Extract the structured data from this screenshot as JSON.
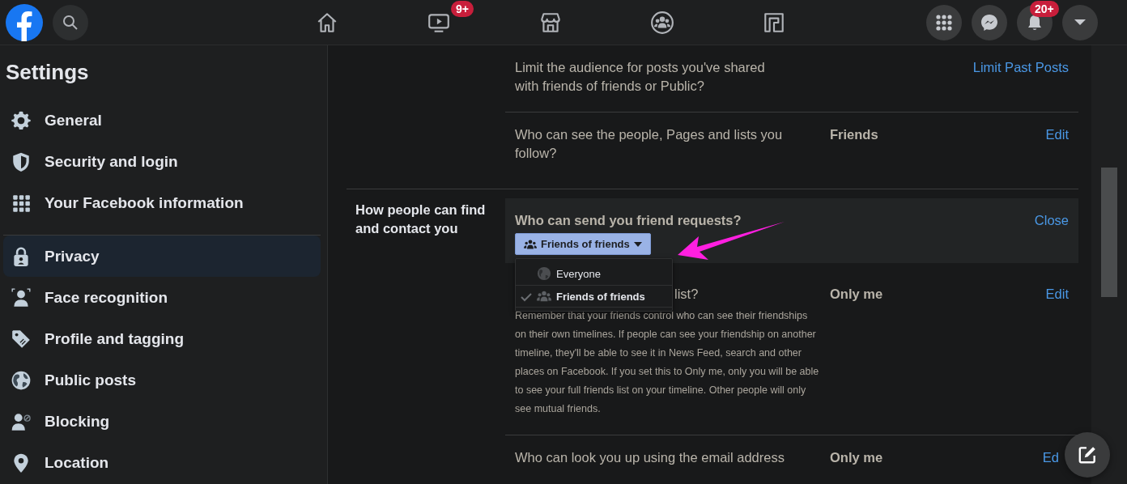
{
  "topbar": {
    "nav": [
      {
        "kind": "home",
        "selected": false
      },
      {
        "kind": "watch",
        "selected": false,
        "badge": "9+"
      },
      {
        "kind": "marketplace",
        "selected": false
      },
      {
        "kind": "groups",
        "selected": false
      },
      {
        "kind": "gaming",
        "selected": false
      }
    ],
    "actions": [
      {
        "kind": "menu"
      },
      {
        "kind": "messenger"
      },
      {
        "kind": "notifications",
        "badge": "20+"
      },
      {
        "kind": "account"
      }
    ]
  },
  "sidebar": {
    "title": "Settings",
    "groups": [
      [
        {
          "kind": "gear",
          "label": "General",
          "selected": false
        },
        {
          "kind": "shield",
          "label": "Security and login",
          "selected": false
        },
        {
          "kind": "grid",
          "label": "Your Facebook information",
          "selected": false
        }
      ],
      [
        {
          "kind": "lock",
          "label": "Privacy",
          "selected": true
        },
        {
          "kind": "face",
          "label": "Face recognition",
          "selected": false
        },
        {
          "kind": "tag",
          "label": "Profile and tagging",
          "selected": false
        },
        {
          "kind": "globe",
          "label": "Public posts",
          "selected": false
        },
        {
          "kind": "block",
          "label": "Blocking",
          "selected": false
        },
        {
          "kind": "pin",
          "label": "Location",
          "selected": false
        }
      ]
    ]
  },
  "sections": [
    {
      "rows": [
        {
          "kind": "collapsed",
          "question": [
            "Limit the audience for posts you've shared",
            "with friends of friends or Public?"
          ],
          "link": "Limit Past Posts"
        },
        {
          "kind": "collapsed",
          "question": [
            "Who can see the people, Pages and lists you",
            "follow?"
          ],
          "value": "Friends",
          "link": "Edit"
        }
      ]
    },
    {
      "label": "How people can find and contact you",
      "rows": [
        {
          "kind": "expanded",
          "question": [
            "Who can send you friend requests?"
          ],
          "link": "Close",
          "dropdown": {
            "button": "Friends of friends",
            "expanded": true,
            "options": [
              {
                "kind": "globe",
                "label": "Everyone",
                "selected": false
              },
              {
                "kind": "friends",
                "label": "Friends of friends",
                "selected": true
              }
            ]
          }
        },
        {
          "kind": "covered",
          "question": [
            "list?"
          ],
          "value": "Only me",
          "link": "Edit",
          "description": [
            "Remember that your friends control who can see their friendships",
            "on their own timelines. If people can see your friendship on another",
            "timeline, they'll be able to see it in News Feed, search and other",
            "places on Facebook. If you set this to Only me, only you will be able",
            "to see your full friends list on your timeline. Other people will only",
            "see mutual friends."
          ]
        },
        {
          "kind": "clipped",
          "question": [
            "Who can look you up using the email address"
          ],
          "value": "Only me",
          "link": "Ed"
        }
      ]
    }
  ]
}
